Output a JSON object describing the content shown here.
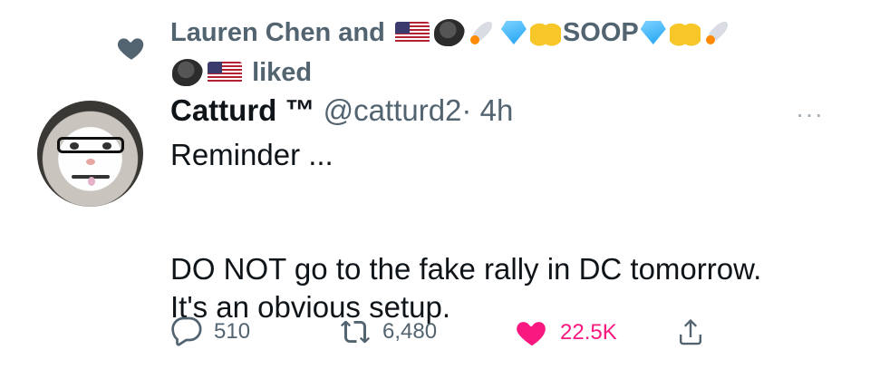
{
  "social_context": {
    "prefix": "Lauren Chen and",
    "suffix": "liked",
    "name_word": "SOOP"
  },
  "tweet": {
    "display_name": "Catturd ™",
    "handle": "@catturd2",
    "separator": "·",
    "time": "4h",
    "more_label": "···",
    "text": "Reminder ...\n\n\nDO NOT go to the fake rally in DC tomorrow.\nIt's an obvious setup."
  },
  "actions": {
    "replies": "510",
    "retweets": "6,480",
    "likes": "22.5K"
  },
  "colors": {
    "muted": "#536471",
    "like": "#f91880",
    "text": "#0f1419"
  },
  "icons": [
    "heart-icon",
    "reply-icon",
    "retweet-icon",
    "like-heart-icon",
    "share-icon",
    "more-icon"
  ]
}
